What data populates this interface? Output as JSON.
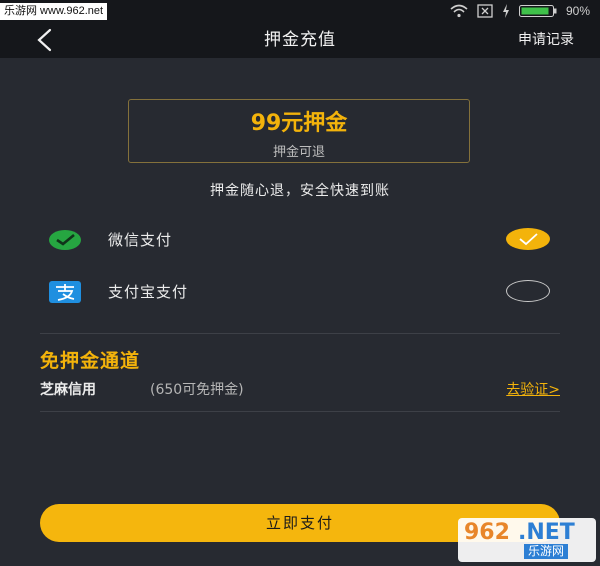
{
  "status_bar": {
    "watermark": "乐游网 www.962.net",
    "battery": "90%"
  },
  "nav": {
    "title": "押金充值",
    "right_link": "申请记录"
  },
  "deposit": {
    "amount": "99元押金",
    "note": "押金可退"
  },
  "tagline": "押金随心退，安全快速到账",
  "payment_methods": [
    {
      "label": "微信支付",
      "icon": "wechat-pay-icon",
      "selected": true
    },
    {
      "label": "支付宝支付",
      "icon": "alipay-icon",
      "selected": false
    }
  ],
  "free_channel": {
    "title": "免押金通道",
    "name": "芝麻信用",
    "score_text": "(650可免押金)",
    "verify_link": "去验证>"
  },
  "submit": {
    "label": "立即支付"
  },
  "bottom_watermark": {
    "num": "962",
    "net": ".NET",
    "cn": "乐游网"
  },
  "colors": {
    "accent": "#f3b30b",
    "background": "#272a31",
    "bar": "#15171b"
  }
}
